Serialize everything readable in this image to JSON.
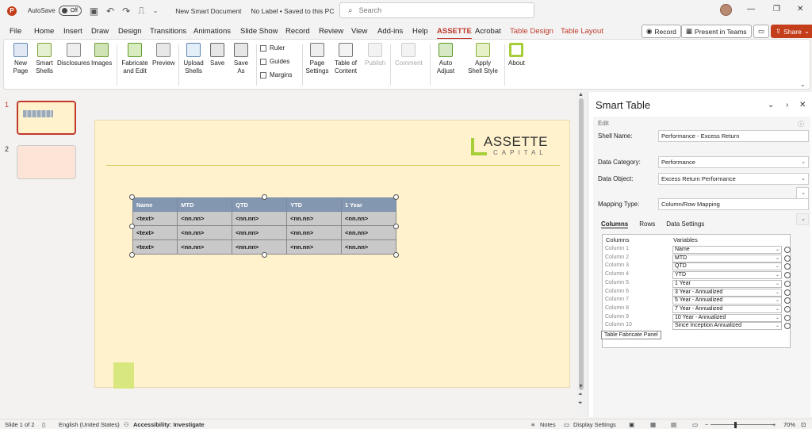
{
  "titlebar": {
    "autosave_label": "AutoSave",
    "autosave_state": "Off",
    "doc_title": "New Smart Document",
    "label_info": "No Label • Saved to this PC",
    "search_placeholder": "Search"
  },
  "menu": {
    "tabs": [
      "File",
      "Home",
      "Insert",
      "Draw",
      "Design",
      "Transitions",
      "Animations",
      "Slide Show",
      "Record",
      "Review",
      "View",
      "Add-ins",
      "Help",
      "ASSETTE",
      "Acrobat",
      "Table Design",
      "Table Layout"
    ],
    "record_label": "Record",
    "present_label": "Present in Teams",
    "share_label": "Share"
  },
  "ribbon": {
    "new_page": "New Page",
    "smart_shells": "Smart Shells",
    "disclosures": "Disclosures",
    "images": "Images",
    "fabricate": "Fabricate and Edit",
    "preview": "Preview",
    "upload_shells": "Upload Shells",
    "save": "Save",
    "save_as": "Save As",
    "ruler": "Ruler",
    "guides": "Guides",
    "margins": "Margins",
    "page_settings": "Page Settings",
    "table_of_content": "Table of Content",
    "publish": "Publish",
    "comment": "Comment",
    "auto_adjust": "Auto Adjust",
    "apply_shell_style": "Apply Shell Style",
    "about": "About"
  },
  "thumbs": {
    "n1": "1",
    "n2": "2"
  },
  "slide": {
    "logo_title": "ASSETTE",
    "logo_sub": "CAPITAL",
    "table_headers": [
      "Name",
      "MTD",
      "QTD",
      "YTD",
      "1 Year"
    ],
    "table_rows": [
      [
        "<text>",
        "<nn.nn>",
        "<nn.nn>",
        "<nn.nn>",
        "<nn.nn>"
      ],
      [
        "<text>",
        "<nn.nn>",
        "<nn.nn>",
        "<nn.nn>",
        "<nn.nn>"
      ],
      [
        "<text>",
        "<nn.nn>",
        "<nn.nn>",
        "<nn.nn>",
        "<nn.nn>"
      ]
    ]
  },
  "taskpane": {
    "title": "Smart Table",
    "edit": "Edit",
    "shell_name_label": "Shell Name:",
    "shell_name_value": "Performance - Excess Return",
    "data_category_label": "Data Category:",
    "data_category_value": "Performance",
    "data_object_label": "Data Object:",
    "data_object_value": "Excess Return Performance",
    "mapping_type_label": "Mapping Type:",
    "mapping_type_value": "Column/Row Mapping",
    "subtabs": [
      "Columns",
      "Rows",
      "Data Settings"
    ],
    "grid_headers": [
      "Columns",
      "Variables"
    ],
    "grid_rows": [
      {
        "col": "Column 1",
        "var": "Name"
      },
      {
        "col": "Column 2",
        "var": "MTD"
      },
      {
        "col": "Column 3",
        "var": "QTD"
      },
      {
        "col": "Column 4",
        "var": "YTD"
      },
      {
        "col": "Column 5",
        "var": "1 Year"
      },
      {
        "col": "Column 6",
        "var": "3 Year - Annualized"
      },
      {
        "col": "Column 7",
        "var": "5 Year - Annualized"
      },
      {
        "col": "Column 8",
        "var": "7 Year - Annualized"
      },
      {
        "col": "Column 9",
        "var": "10 Year - Annualized"
      },
      {
        "col": "Column 10",
        "var": "Since Inception Annualized"
      }
    ],
    "tooltip": "Table Fabricate Panel"
  },
  "status": {
    "slide": "Slide 1 of 2",
    "language": "English (United States)",
    "accessibility": "Accessibility: Investigate",
    "notes": "Notes",
    "display_settings": "Display Settings",
    "zoom": "70%"
  },
  "colors": {
    "accent": "#c0392b",
    "slide_bg": "#fff2cc",
    "table_header": "#8497b0",
    "table_cell": "#c9c9c9",
    "logo_green": "#a6ce39"
  }
}
